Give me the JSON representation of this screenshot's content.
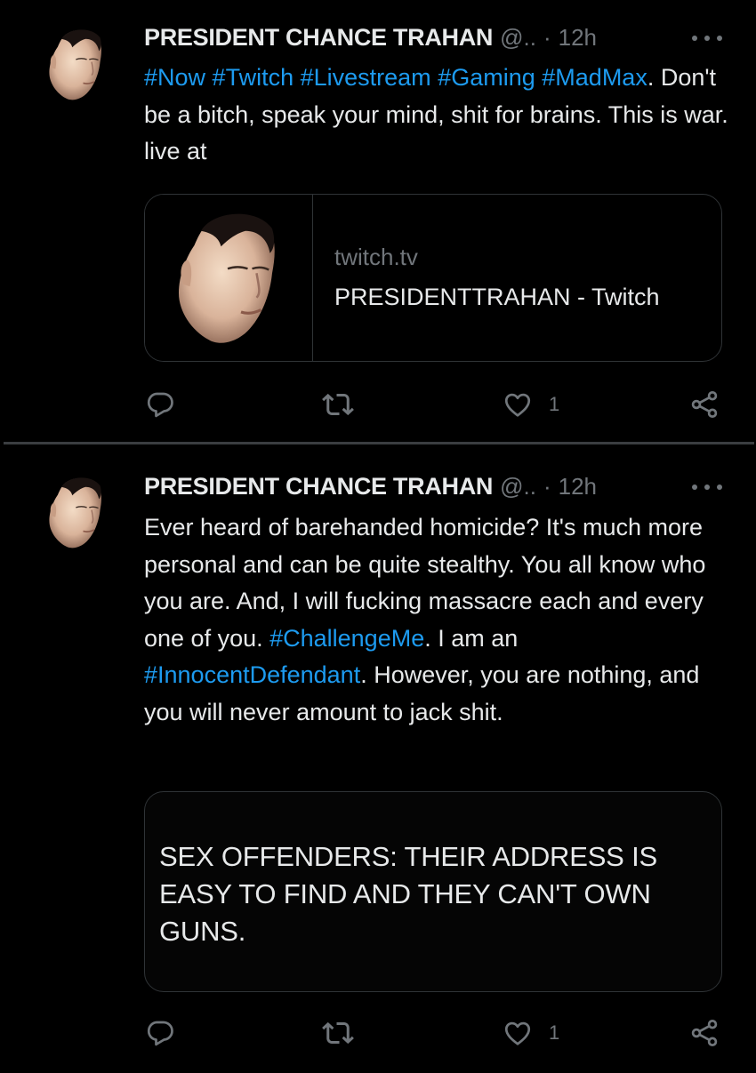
{
  "tweets": [
    {
      "author": {
        "name": "PRESIDENT CHANCE TRAHAN",
        "handle": "@..",
        "separator": "·",
        "time": "12h",
        "avatar_icon": "avatar-face-image"
      },
      "text": [
        {
          "type": "hashtag",
          "value": "#Now"
        },
        {
          "type": "text",
          "value": " "
        },
        {
          "type": "hashtag",
          "value": "#Twitch"
        },
        {
          "type": "text",
          "value": " "
        },
        {
          "type": "hashtag",
          "value": "#Livestream"
        },
        {
          "type": "text",
          "value": " "
        },
        {
          "type": "hashtag",
          "value": "#Gaming"
        },
        {
          "type": "text",
          "value": " "
        },
        {
          "type": "hashtag",
          "value": "#MadMax"
        },
        {
          "type": "text",
          "value": ". Don't be a bitch, speak your mind, shit for brains. This is war.  live at"
        }
      ],
      "card": {
        "type": "link",
        "domain": "twitch.tv",
        "title": "PRESIDENTTRAHAN - Twitch",
        "thumbnail_icon": "card-thumbnail-face-image"
      },
      "actions": {
        "reply_icon": "reply-icon",
        "retweet_icon": "retweet-icon",
        "like_icon": "heart-icon",
        "like_count": "1",
        "share_icon": "share-icon"
      }
    },
    {
      "author": {
        "name": "PRESIDENT CHANCE TRAHAN",
        "handle": "@..",
        "separator": "·",
        "time": "12h",
        "avatar_icon": "avatar-face-image"
      },
      "text": [
        {
          "type": "text",
          "value": "Ever heard of barehanded homicide? It's much more personal and can be quite stealthy. You all know who you are. And, I will fucking massacre each and every one of you. "
        },
        {
          "type": "hashtag",
          "value": "#ChallengeMe"
        },
        {
          "type": "text",
          "value": ". I am an "
        },
        {
          "type": "hashtag",
          "value": "#InnocentDefendant"
        },
        {
          "type": "text",
          "value": ". However, you are nothing, and you will never amount to jack shit."
        }
      ],
      "card": {
        "type": "image-text",
        "text": "SEX OFFENDERS: THEIR ADDRESS IS EASY TO FIND AND THEY CAN'T OWN GUNS."
      },
      "actions": {
        "reply_icon": "reply-icon",
        "retweet_icon": "retweet-icon",
        "like_icon": "heart-icon",
        "like_count": "1",
        "share_icon": "share-icon"
      }
    }
  ],
  "colors": {
    "background": "#000000",
    "text_primary": "#e7e9ea",
    "text_secondary": "#71767b",
    "hashtag": "#1d9bf0",
    "border": "#2f3336",
    "divider": "#3a3d40"
  }
}
